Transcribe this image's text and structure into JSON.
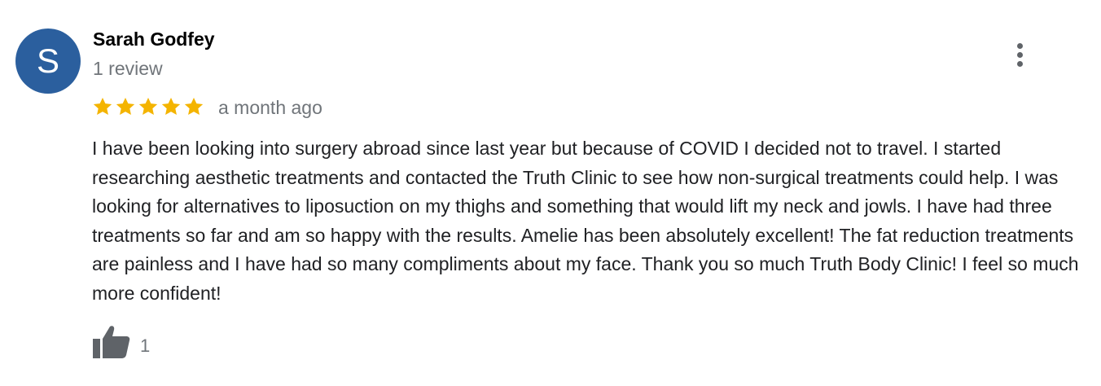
{
  "review": {
    "avatar_letter": "S",
    "avatar_color": "#2b5f9e",
    "author_name": "Sarah Godfey",
    "author_review_count": "1 review",
    "rating": 5,
    "rating_max": 5,
    "star_color": "#f4b400",
    "time_ago": "a month ago",
    "text": "I have been looking into surgery abroad since last year but because of COVID I decided not to travel. I started researching aesthetic treatments and contacted the Truth Clinic to see how non-surgical treatments could help. I was looking for alternatives to liposuction on my thighs and something that would lift my neck and jowls. I have had three treatments so far and am so happy with the results. Amelie has been absolutely excellent! The fat reduction treatments are painless and I have had so many compliments about my face. Thank you so much Truth Body Clinic! I feel so much more confident!",
    "like_count": "1"
  },
  "icons": {
    "more": "more-vert-icon",
    "like": "thumbs-up-icon",
    "star": "star-icon"
  }
}
